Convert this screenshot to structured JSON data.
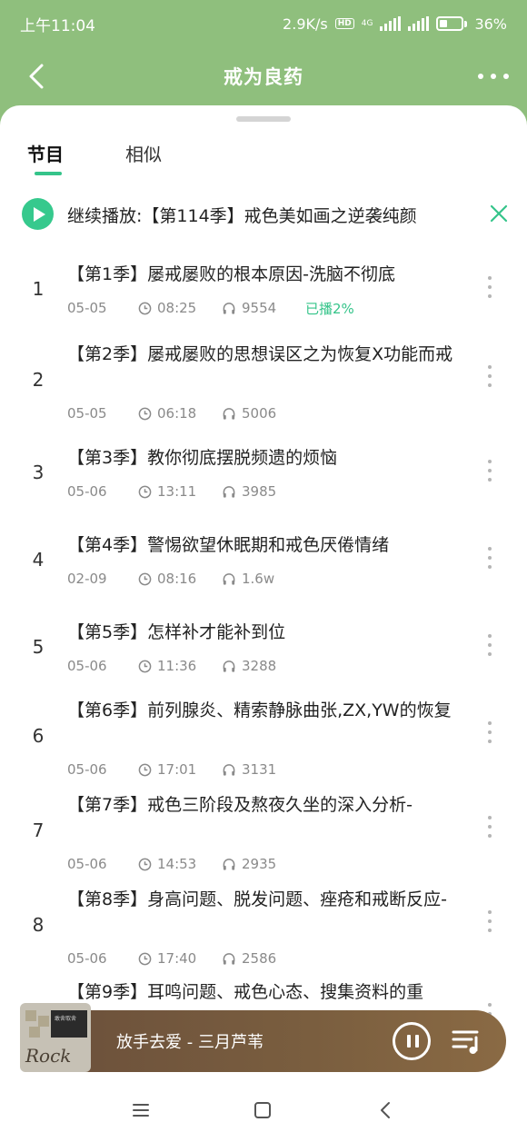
{
  "status_bar": {
    "time": "上午11:04",
    "net_speed": "2.9K/s",
    "hd": "HD",
    "net_type": "4G",
    "battery": "36%",
    "battery_level": 0.36
  },
  "header": {
    "title": "戒为良药"
  },
  "tabs": [
    {
      "label": "节目",
      "active": true
    },
    {
      "label": "相似",
      "active": false
    }
  ],
  "continue_bar": {
    "text": "继续播放:【第114季】戒色美如画之逆袭纯颜"
  },
  "episodes": [
    {
      "index": "1",
      "title": "【第1季】屡戒屡败的根本原因-洗脑不彻底",
      "date": "05-05",
      "duration": "08:25",
      "plays": "9554",
      "progress": "已播2%"
    },
    {
      "index": "2",
      "title": "【第2季】屡戒屡败的思想误区之为恢复X功能而戒",
      "date": "05-05",
      "duration": "06:18",
      "plays": "5006"
    },
    {
      "index": "3",
      "title": "【第3季】教你彻底摆脱频遗的烦恼",
      "date": "05-06",
      "duration": "13:11",
      "plays": "3985"
    },
    {
      "index": "4",
      "title": "【第4季】警惕欲望休眠期和戒色厌倦情绪",
      "date": "02-09",
      "duration": "08:16",
      "plays": "1.6w"
    },
    {
      "index": "5",
      "title": "【第5季】怎样补才能补到位",
      "date": "05-06",
      "duration": "11:36",
      "plays": "3288"
    },
    {
      "index": "6",
      "title": "【第6季】前列腺炎、精索静脉曲张,ZX,YW的恢复",
      "date": "05-06",
      "duration": "17:01",
      "plays": "3131"
    },
    {
      "index": "7",
      "title": "【第7季】戒色三阶段及熬夜久坐的深入分析-",
      "date": "05-06",
      "duration": "14:53",
      "plays": "2935"
    },
    {
      "index": "8",
      "title": "【第8季】身高问题、脱发问题、痤疮和戒断反应-",
      "date": "05-06",
      "duration": "17:40",
      "plays": "2586"
    },
    {
      "index": "",
      "title": "【第9季】耳鸣问题、戒色心态、搜集资料的重"
    }
  ],
  "player": {
    "song": "放手去爱 - 三月芦苇",
    "cover_script": "Rock",
    "cover_label": "敢舍取舍"
  },
  "colors": {
    "header_green": "#8fbf7d",
    "accent_green": "#35c48a",
    "player_brown": "#7a5e3f"
  },
  "icons": [
    "back-arrow-icon",
    "more-icon",
    "play-icon",
    "close-icon",
    "clock-icon",
    "headphones-icon",
    "pause-icon",
    "playlist-icon",
    "menu-icon",
    "home-icon",
    "back-icon"
  ]
}
